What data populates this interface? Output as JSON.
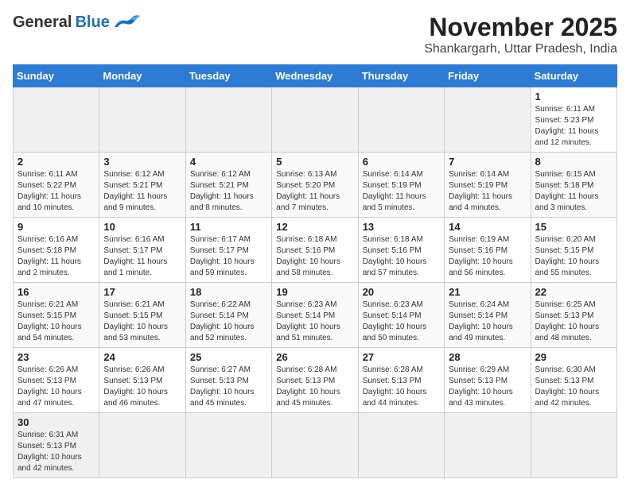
{
  "header": {
    "logo_general": "General",
    "logo_blue": "Blue",
    "month_title": "November 2025",
    "subtitle": "Shankargarh, Uttar Pradesh, India"
  },
  "days_of_week": [
    "Sunday",
    "Monday",
    "Tuesday",
    "Wednesday",
    "Thursday",
    "Friday",
    "Saturday"
  ],
  "weeks": [
    [
      {
        "day": "",
        "info": ""
      },
      {
        "day": "",
        "info": ""
      },
      {
        "day": "",
        "info": ""
      },
      {
        "day": "",
        "info": ""
      },
      {
        "day": "",
        "info": ""
      },
      {
        "day": "",
        "info": ""
      },
      {
        "day": "1",
        "info": "Sunrise: 6:11 AM\nSunset: 5:23 PM\nDaylight: 11 hours\nand 12 minutes."
      }
    ],
    [
      {
        "day": "2",
        "info": "Sunrise: 6:11 AM\nSunset: 5:22 PM\nDaylight: 11 hours\nand 10 minutes."
      },
      {
        "day": "3",
        "info": "Sunrise: 6:12 AM\nSunset: 5:21 PM\nDaylight: 11 hours\nand 9 minutes."
      },
      {
        "day": "4",
        "info": "Sunrise: 6:12 AM\nSunset: 5:21 PM\nDaylight: 11 hours\nand 8 minutes."
      },
      {
        "day": "5",
        "info": "Sunrise: 6:13 AM\nSunset: 5:20 PM\nDaylight: 11 hours\nand 7 minutes."
      },
      {
        "day": "6",
        "info": "Sunrise: 6:14 AM\nSunset: 5:19 PM\nDaylight: 11 hours\nand 5 minutes."
      },
      {
        "day": "7",
        "info": "Sunrise: 6:14 AM\nSunset: 5:19 PM\nDaylight: 11 hours\nand 4 minutes."
      },
      {
        "day": "8",
        "info": "Sunrise: 6:15 AM\nSunset: 5:18 PM\nDaylight: 11 hours\nand 3 minutes."
      }
    ],
    [
      {
        "day": "9",
        "info": "Sunrise: 6:16 AM\nSunset: 5:18 PM\nDaylight: 11 hours\nand 2 minutes."
      },
      {
        "day": "10",
        "info": "Sunrise: 6:16 AM\nSunset: 5:17 PM\nDaylight: 11 hours\nand 1 minute."
      },
      {
        "day": "11",
        "info": "Sunrise: 6:17 AM\nSunset: 5:17 PM\nDaylight: 10 hours\nand 59 minutes."
      },
      {
        "day": "12",
        "info": "Sunrise: 6:18 AM\nSunset: 5:16 PM\nDaylight: 10 hours\nand 58 minutes."
      },
      {
        "day": "13",
        "info": "Sunrise: 6:18 AM\nSunset: 5:16 PM\nDaylight: 10 hours\nand 57 minutes."
      },
      {
        "day": "14",
        "info": "Sunrise: 6:19 AM\nSunset: 5:16 PM\nDaylight: 10 hours\nand 56 minutes."
      },
      {
        "day": "15",
        "info": "Sunrise: 6:20 AM\nSunset: 5:15 PM\nDaylight: 10 hours\nand 55 minutes."
      }
    ],
    [
      {
        "day": "16",
        "info": "Sunrise: 6:21 AM\nSunset: 5:15 PM\nDaylight: 10 hours\nand 54 minutes."
      },
      {
        "day": "17",
        "info": "Sunrise: 6:21 AM\nSunset: 5:15 PM\nDaylight: 10 hours\nand 53 minutes."
      },
      {
        "day": "18",
        "info": "Sunrise: 6:22 AM\nSunset: 5:14 PM\nDaylight: 10 hours\nand 52 minutes."
      },
      {
        "day": "19",
        "info": "Sunrise: 6:23 AM\nSunset: 5:14 PM\nDaylight: 10 hours\nand 51 minutes."
      },
      {
        "day": "20",
        "info": "Sunrise: 6:23 AM\nSunset: 5:14 PM\nDaylight: 10 hours\nand 50 minutes."
      },
      {
        "day": "21",
        "info": "Sunrise: 6:24 AM\nSunset: 5:14 PM\nDaylight: 10 hours\nand 49 minutes."
      },
      {
        "day": "22",
        "info": "Sunrise: 6:25 AM\nSunset: 5:13 PM\nDaylight: 10 hours\nand 48 minutes."
      }
    ],
    [
      {
        "day": "23",
        "info": "Sunrise: 6:26 AM\nSunset: 5:13 PM\nDaylight: 10 hours\nand 47 minutes."
      },
      {
        "day": "24",
        "info": "Sunrise: 6:26 AM\nSunset: 5:13 PM\nDaylight: 10 hours\nand 46 minutes."
      },
      {
        "day": "25",
        "info": "Sunrise: 6:27 AM\nSunset: 5:13 PM\nDaylight: 10 hours\nand 45 minutes."
      },
      {
        "day": "26",
        "info": "Sunrise: 6:28 AM\nSunset: 5:13 PM\nDaylight: 10 hours\nand 45 minutes."
      },
      {
        "day": "27",
        "info": "Sunrise: 6:28 AM\nSunset: 5:13 PM\nDaylight: 10 hours\nand 44 minutes."
      },
      {
        "day": "28",
        "info": "Sunrise: 6:29 AM\nSunset: 5:13 PM\nDaylight: 10 hours\nand 43 minutes."
      },
      {
        "day": "29",
        "info": "Sunrise: 6:30 AM\nSunset: 5:13 PM\nDaylight: 10 hours\nand 42 minutes."
      }
    ],
    [
      {
        "day": "30",
        "info": "Sunrise: 6:31 AM\nSunset: 5:13 PM\nDaylight: 10 hours\nand 42 minutes."
      },
      {
        "day": "",
        "info": ""
      },
      {
        "day": "",
        "info": ""
      },
      {
        "day": "",
        "info": ""
      },
      {
        "day": "",
        "info": ""
      },
      {
        "day": "",
        "info": ""
      },
      {
        "day": "",
        "info": ""
      }
    ]
  ]
}
